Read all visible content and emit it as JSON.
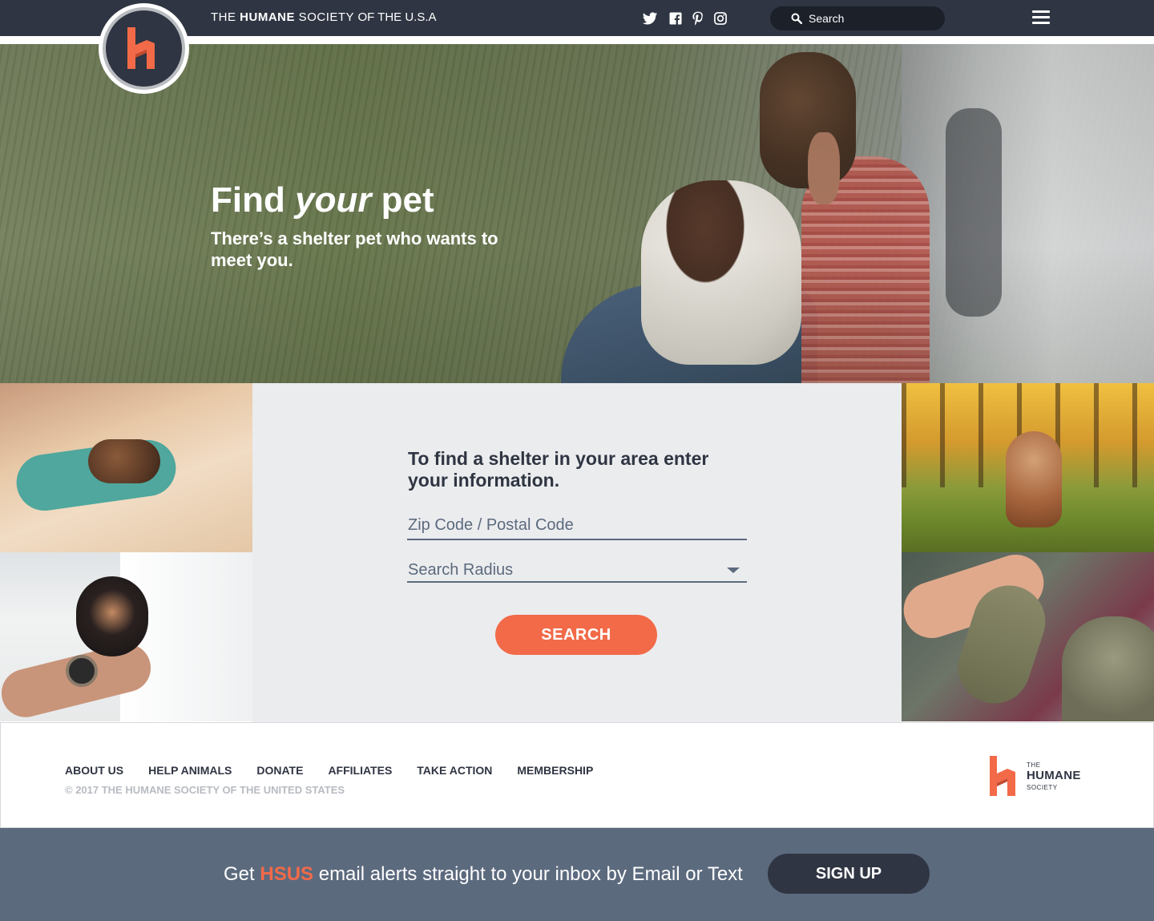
{
  "header": {
    "brand": {
      "prefix": "THE ",
      "strong": "HUMANE",
      "middle": " SOCIETY ",
      "suffix": "OF THE U.S.A"
    },
    "social_icons": [
      "twitter-icon",
      "facebook-icon",
      "pinterest-icon",
      "instagram-icon"
    ],
    "search": {
      "placeholder": "Search"
    },
    "menu_icon": "hamburger-menu-icon",
    "logo_icon": "humane-society-h-logo"
  },
  "hero": {
    "title_before": "Find ",
    "title_emphasis": "your",
    "title_after": " pet",
    "subtitle": "There’s a shelter pet who wants to meet you."
  },
  "finder": {
    "title": "To find a shelter in your area enter your information.",
    "zip_placeholder": "Zip Code / Postal Code",
    "radius_label": "Search Radius",
    "search_button": "SEARCH"
  },
  "footer": {
    "nav": [
      "ABOUT US",
      "HELP ANIMALS",
      "DONATE",
      "AFFILIATES",
      "TAKE ACTION",
      "MEMBERSHIP"
    ],
    "copyright": "© 2017 THE HUMANE SOCIETY OF THE UNITED STATES",
    "logo": {
      "line1": "THE",
      "line2": "HUMANE",
      "line3": "SOCIETY"
    }
  },
  "signup": {
    "text_before": "Get ",
    "highlight": "HSUS",
    "text_after": " email alerts straight to your inbox by Email or Text",
    "button": "SIGN UP"
  },
  "colors": {
    "dark_navy": "#2f3542",
    "accent_orange": "#f26a48",
    "slate": "#5c6a7e",
    "panel_gray": "#ebecee"
  }
}
